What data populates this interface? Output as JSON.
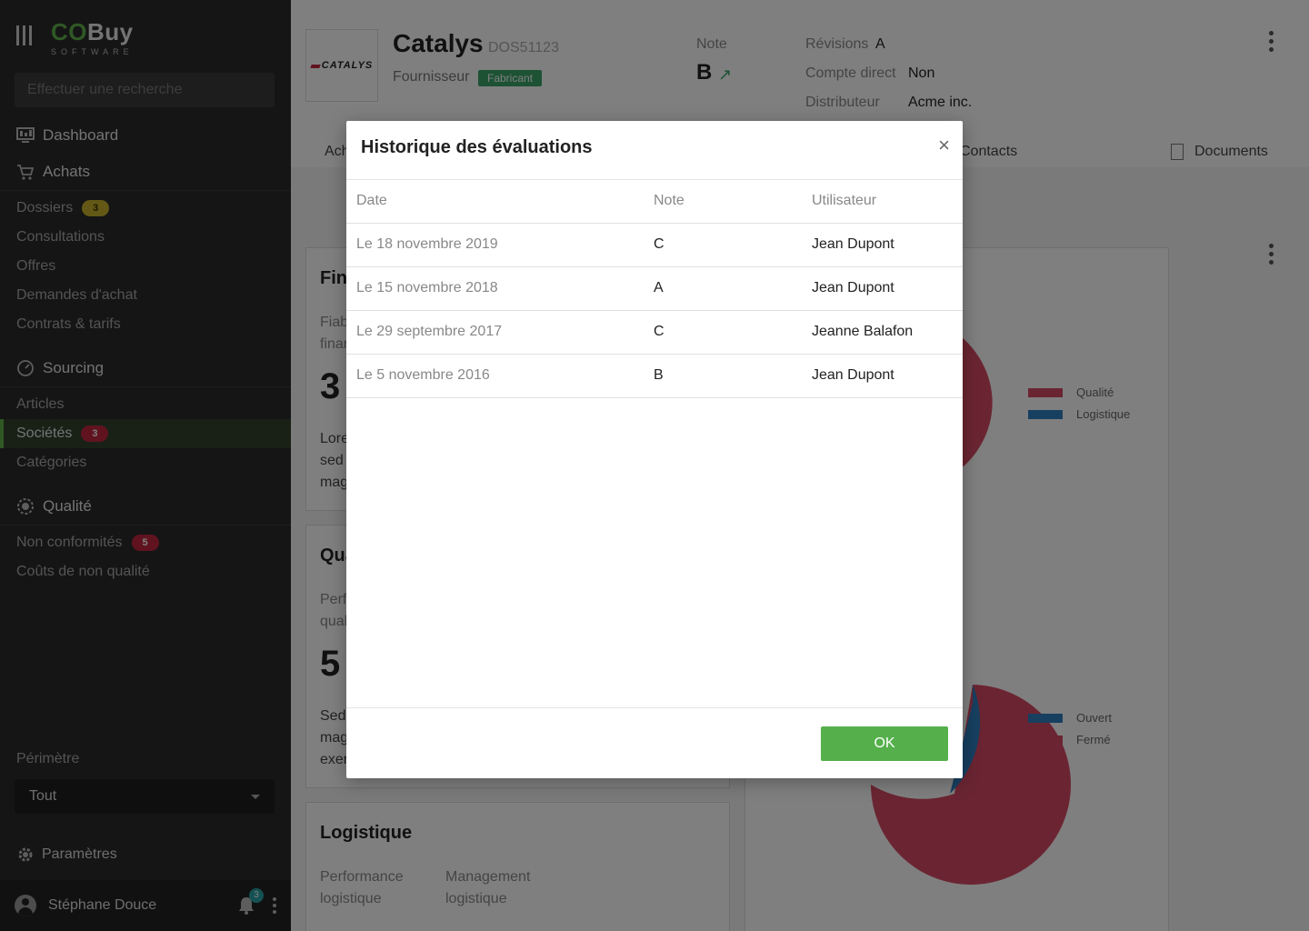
{
  "app": {
    "brand_co": "CO",
    "brand_buy": "Buy",
    "brand_sub": "SOFTWARE",
    "search_placeholder": "Effectuer une recherche"
  },
  "sidebar": {
    "dashboard": "Dashboard",
    "achats": {
      "label": "Achats",
      "items": [
        {
          "label": "Dossiers",
          "badge": "3"
        },
        {
          "label": "Consultations"
        },
        {
          "label": "Offres"
        },
        {
          "label": "Demandes d'achat"
        },
        {
          "label": "Contrats & tarifs"
        }
      ]
    },
    "sourcing": {
      "label": "Sourcing",
      "items": [
        {
          "label": "Articles"
        },
        {
          "label": "Sociétés",
          "badge": "3"
        },
        {
          "label": "Catégories"
        }
      ]
    },
    "qualite": {
      "label": "Qualité",
      "items": [
        {
          "label": "Non conformités",
          "badge": "5"
        },
        {
          "label": "Coûts de non qualité"
        }
      ]
    },
    "perimetre_label": "Périmètre",
    "perimetre_value": "Tout",
    "settings": "Paramètres",
    "user": "Stéphane Douce",
    "notifications": "3"
  },
  "company": {
    "logo_text": "CATALYS",
    "name": "Catalys",
    "code": "DOS51123",
    "role": "Fournisseur",
    "tag": "Fabricant",
    "note_label": "Note",
    "note_value": "B",
    "note_arrow": "↗",
    "revisions_label": "Révisions",
    "revisions_value": "A",
    "compte_label": "Compte direct",
    "compte_value": "Non",
    "distrib_label": "Distributeur",
    "distrib_value": "Acme inc."
  },
  "tabs": {
    "partial": "Ach",
    "contacts": "Contacts",
    "documents": "Documents"
  },
  "cards": {
    "fin": {
      "title": "Fin",
      "sub1": "Fiab",
      "sub2": "finar",
      "big": "3",
      "body1": "Lore",
      "body2": "sed c",
      "body3": "mag"
    },
    "qua": {
      "title": "Qua",
      "sub1": "Perf",
      "sub2": "qual",
      "big": "5",
      "body1": "Sed",
      "body2": "mag",
      "body3": "exer"
    },
    "log": {
      "title": "Logistique",
      "col1a": "Performance",
      "col1b": "logistique",
      "col2a": "Management",
      "col2b": "logistique"
    }
  },
  "legend_top": [
    {
      "label": "Qualité",
      "color": "#d64a64"
    },
    {
      "label": "Logistique",
      "color": "#2f7fc0"
    }
  ],
  "legend_bottom": [
    {
      "label": "Ouvert",
      "color": "#2f7fc0"
    },
    {
      "label": "Fermé",
      "color": "#d64a64"
    }
  ],
  "modal": {
    "title": "Historique des évaluations",
    "close": "×",
    "columns": [
      "Date",
      "Note",
      "Utilisateur"
    ],
    "rows": [
      {
        "date": "Le 18 novembre 2019",
        "note": "C",
        "user": "Jean Dupont"
      },
      {
        "date": "Le 15 novembre 2018",
        "note": "A",
        "user": "Jean Dupont"
      },
      {
        "date": "Le 29 septembre 2017",
        "note": "C",
        "user": "Jeanne Balafon"
      },
      {
        "date": "Le 5 novembre 2016",
        "note": "B",
        "user": "Jean Dupont"
      }
    ],
    "ok": "OK"
  }
}
